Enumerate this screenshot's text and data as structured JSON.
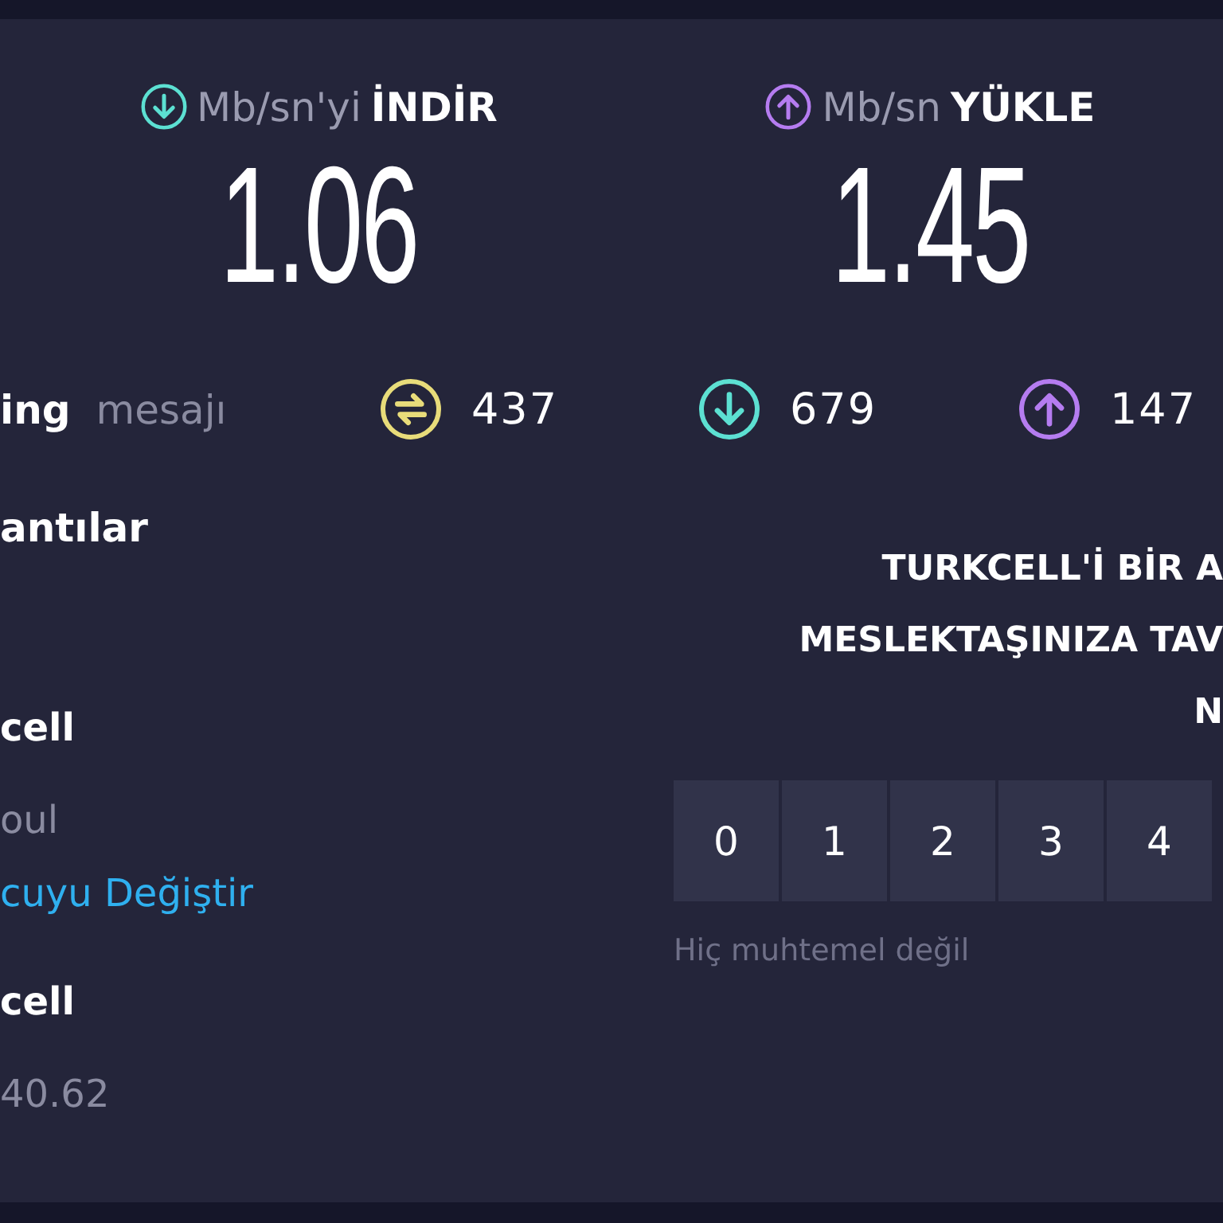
{
  "results": [
    {
      "kind": "download",
      "unit": "Mb/sn'yi",
      "action": "İNDİR",
      "value": "1.06"
    },
    {
      "kind": "upload",
      "unit": "Mb/sn",
      "action": "YÜKLE",
      "value": "1.45"
    }
  ],
  "ping": {
    "label": "ing",
    "unit": "mesajı",
    "stats": [
      {
        "kind": "jitter",
        "value": "437"
      },
      {
        "kind": "download",
        "value": "679"
      },
      {
        "kind": "upload",
        "value": "147"
      }
    ]
  },
  "connections": {
    "title": "antılar",
    "items": [
      {
        "kind": "name",
        "text": "cell"
      },
      {
        "kind": "detail",
        "text": "oul"
      },
      {
        "kind": "link",
        "text": "cuyu Değiştir"
      },
      {
        "kind": "name",
        "text": "cell"
      },
      {
        "kind": "detail",
        "text": "40.62"
      }
    ]
  },
  "survey": {
    "question_lines": [
      "TURKCELL'İ BİR A",
      "MESLEKTAŞINIZA TAV",
      "N"
    ],
    "scale": [
      {
        "label": "0",
        "selected": false
      },
      {
        "label": "1",
        "selected": false
      },
      {
        "label": "2",
        "selected": false
      },
      {
        "label": "3",
        "selected": false
      },
      {
        "label": "4",
        "selected": false
      }
    ],
    "low_label": "Hiç muhtemel değil"
  }
}
